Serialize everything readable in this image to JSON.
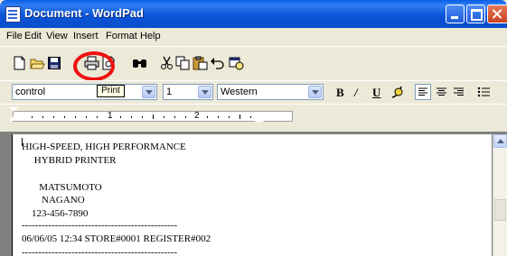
{
  "window": {
    "title": "Document - WordPad"
  },
  "menu": [
    {
      "label": "File"
    },
    {
      "label": "Edit"
    },
    {
      "label": "View"
    },
    {
      "label": "Insert"
    },
    {
      "label": "Format"
    },
    {
      "label": "Help"
    }
  ],
  "toolbar": {
    "icons": [
      "new-document-icon",
      "open-folder-icon",
      "save-icon",
      "print-icon",
      "print-preview-icon",
      "find-icon",
      "cut-icon",
      "copy-icon",
      "paste-icon",
      "undo-icon",
      "insert-date-time-icon"
    ],
    "tooltip": "Print",
    "highlight_color": "#ee1111"
  },
  "format": {
    "font_name": "control",
    "font_size": "1",
    "script": "Western",
    "bold_label": "B",
    "italic_label": "/",
    "underline_label": "U"
  },
  "ruler": {
    "numbers": [
      "1",
      "2"
    ]
  },
  "document": {
    "lines": [
      "HIGH-SPEED, HIGH PERFORMANCE",
      "     HYBRID PRINTER",
      "",
      "       MATSUMOTO",
      "        NAGANO",
      "    123-456-7890",
      "-----------------------------------------------",
      "06/06/05 12:34 STORE#0001 REGISTER#002",
      "-----------------------------------------------"
    ]
  }
}
